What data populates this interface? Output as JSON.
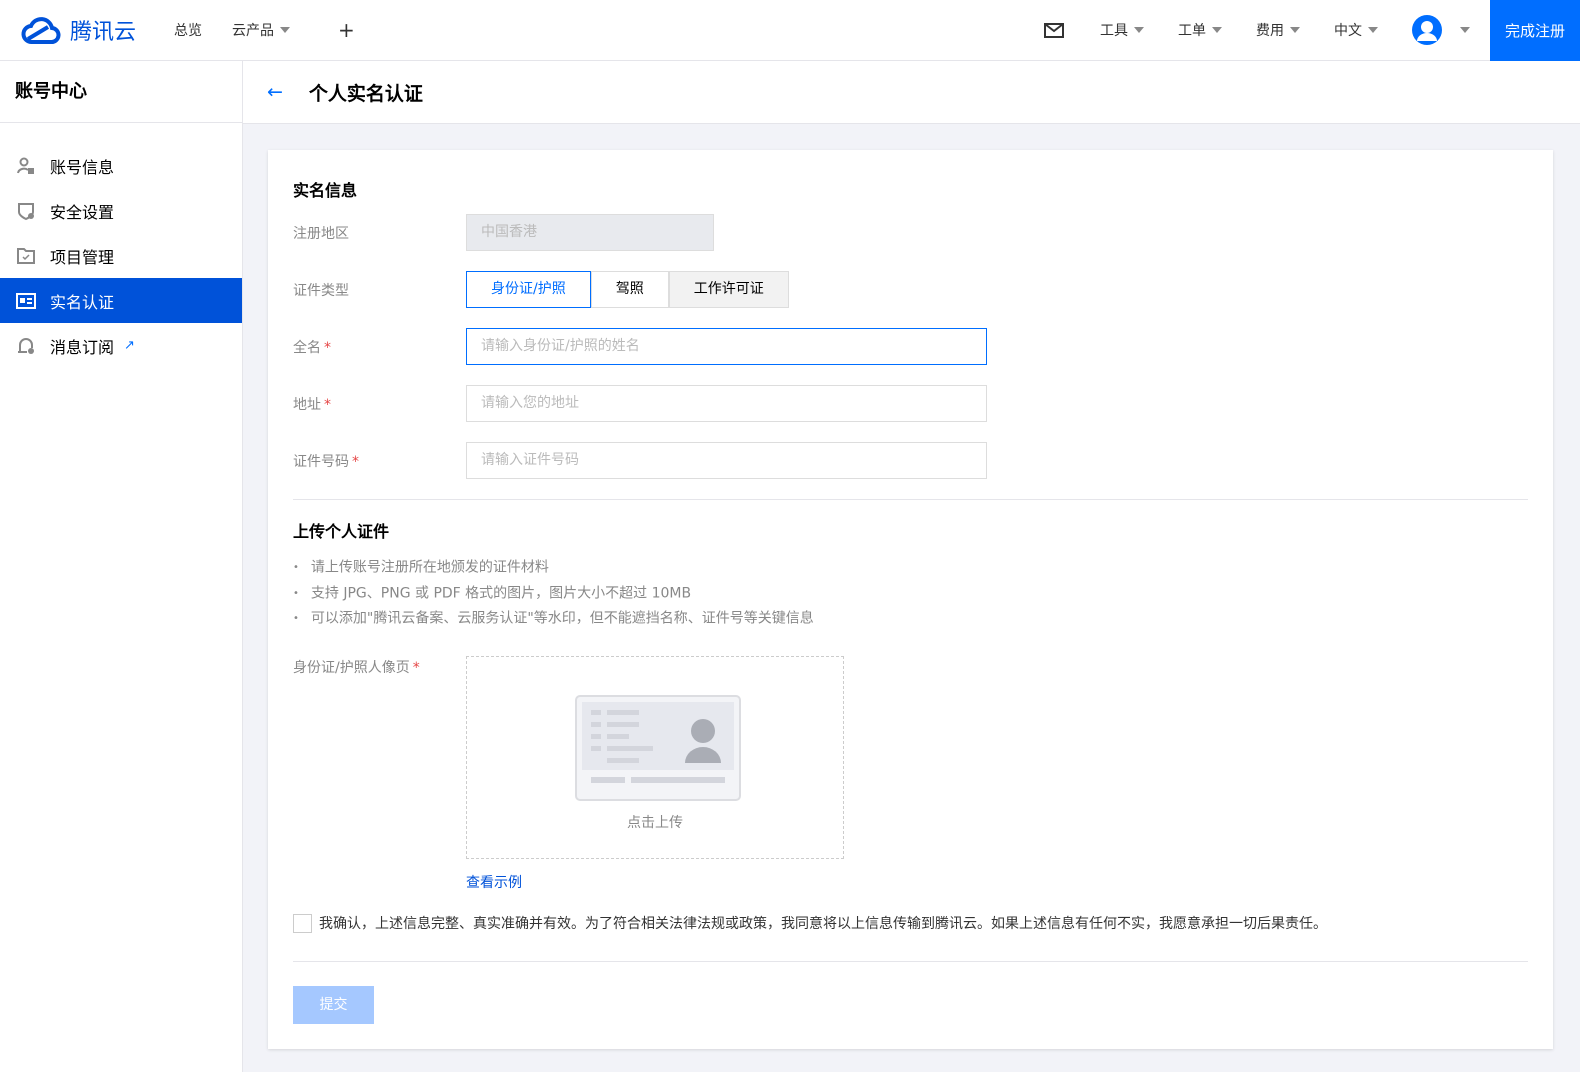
{
  "header": {
    "brand": "腾讯云",
    "nav": [
      "总览",
      "云产品"
    ],
    "right": [
      "工具",
      "工单",
      "费用",
      "中文"
    ],
    "register": "完成注册"
  },
  "sidebar": {
    "title": "账号中心",
    "items": [
      "账号信息",
      "安全设置",
      "项目管理",
      "实名认证",
      "消息订阅"
    ]
  },
  "page": {
    "title": "个人实名认证"
  },
  "form": {
    "section1": "实名信息",
    "region_label": "注册地区",
    "region_value": "中国香港",
    "type_label": "证件类型",
    "types": [
      "身份证/护照",
      "驾照",
      "工作许可证"
    ],
    "name_label": "全名",
    "name_ph": "请输入身份证/护照的姓名",
    "addr_label": "地址",
    "addr_ph": "请输入您的地址",
    "id_label": "证件号码",
    "id_ph": "请输入证件号码",
    "section2": "上传个人证件",
    "tips": [
      "请上传账号注册所在地颁发的证件材料",
      "支持 JPG、PNG 或 PDF 格式的图片，图片大小不超过 10MB",
      "可以添加\"腾讯云备案、云服务认证\"等水印，但不能遮挡名称、证件号等关键信息"
    ],
    "upload_label": "身份证/护照人像页",
    "upload_text": "点击上传",
    "example": "查看示例",
    "confirm": "我确认，上述信息完整、真实准确并有效。为了符合相关法律法规或政策，我同意将以上信息传输到腾讯云。如果上述信息有任何不实，我愿意承担一切后果责任。",
    "submit": "提交"
  }
}
